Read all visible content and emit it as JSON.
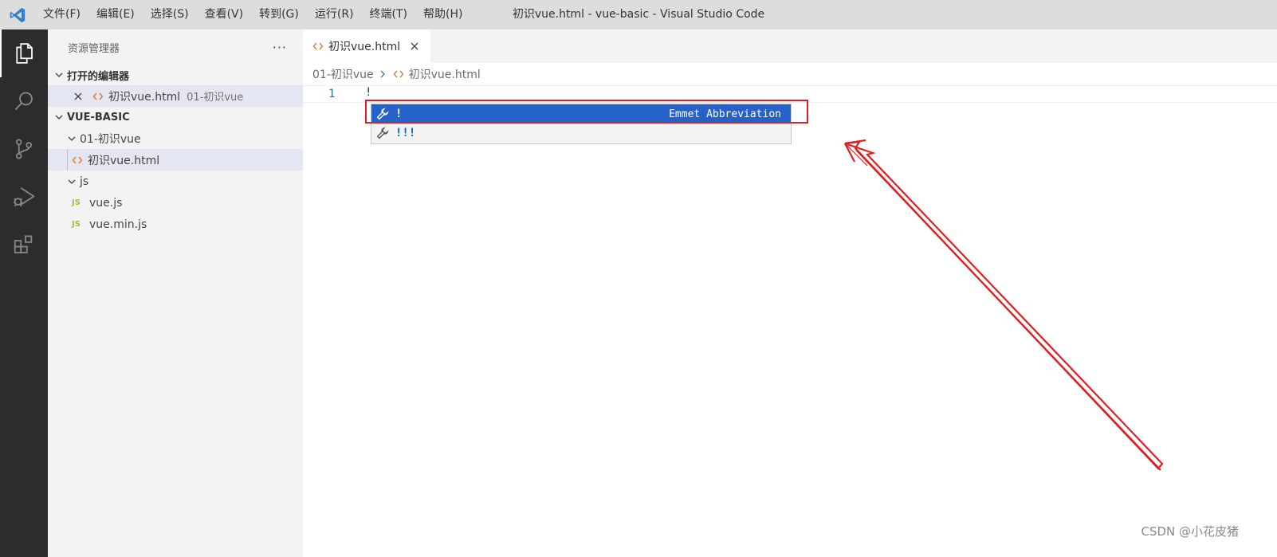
{
  "titlebar": {
    "menu": [
      "文件(F)",
      "编辑(E)",
      "选择(S)",
      "查看(V)",
      "转到(G)",
      "运行(R)",
      "终端(T)",
      "帮助(H)"
    ],
    "window_title": "初识vue.html - vue-basic - Visual Studio Code"
  },
  "activity_bar": {
    "items": [
      "files-icon",
      "search-icon",
      "source-control-icon",
      "run-debug-icon",
      "extensions-icon"
    ]
  },
  "sidebar": {
    "title": "资源管理器",
    "more": "···",
    "open_editors": {
      "header": "打开的编辑器",
      "items": [
        {
          "name": "初识vue.html",
          "folder": "01-初识vue"
        }
      ]
    },
    "workspace": {
      "header": "VUE-BASIC",
      "folder1": "01-初识vue",
      "file1": "初识vue.html",
      "folder2": "js",
      "file2": "vue.js",
      "file3": "vue.min.js",
      "js_badge": "JS"
    }
  },
  "editor": {
    "tab_label": "初识vue.html",
    "breadcrumb": [
      "01-初识vue",
      "初识vue.html"
    ],
    "line_number": "1",
    "line_text": "!",
    "suggestions": [
      {
        "label": "!",
        "detail": "Emmet Abbreviation",
        "focused": true
      },
      {
        "label": "!!!",
        "detail": "",
        "focused": false
      }
    ]
  },
  "watermark": "CSDN @小花皮猪",
  "colors": {
    "accent": "#2561c8",
    "annotation_red": "#e02020",
    "activity_bar": "#2c2c2c",
    "html_icon": "#e37933"
  }
}
